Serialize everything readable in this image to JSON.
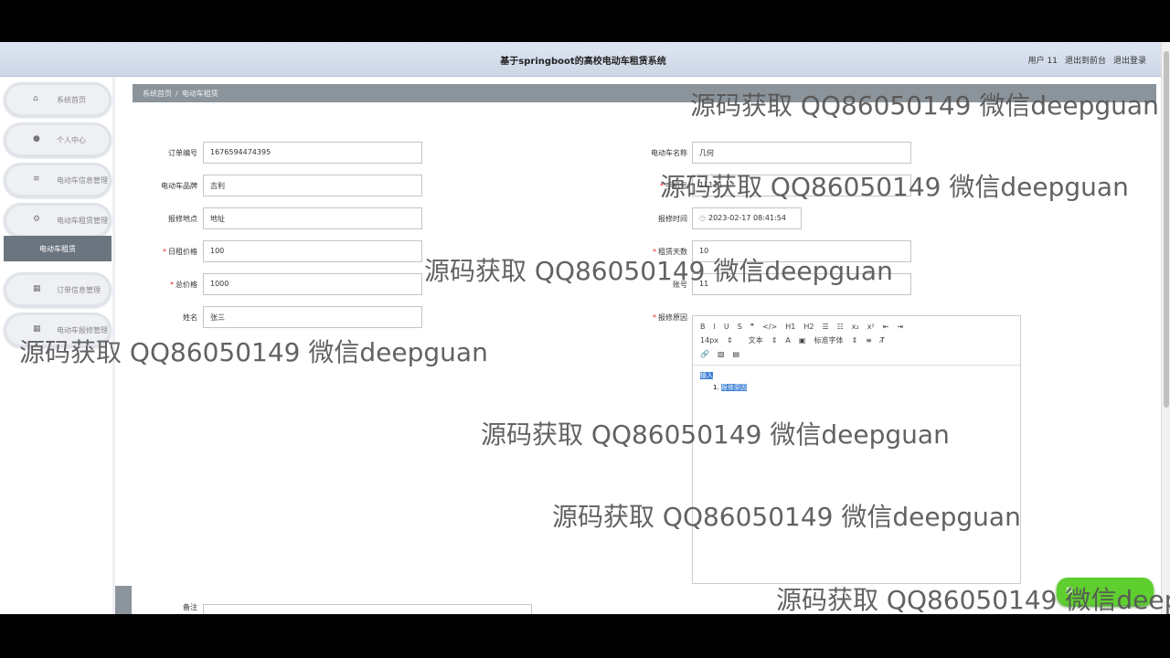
{
  "header": {
    "title": "基于springboot的高校电动车租赁系统",
    "user": "用户 11",
    "to_front": "退出到前台",
    "logout": "退出登录"
  },
  "sidebar": {
    "items": [
      {
        "label": "系统首页",
        "icon": "home-icon"
      },
      {
        "label": "个人中心",
        "icon": "user-icon"
      },
      {
        "label": "电动车信息管理",
        "icon": "list-icon"
      },
      {
        "label": "电动车租赁管理",
        "icon": "bike-icon"
      },
      {
        "label": "订单信息管理",
        "icon": "grid-icon"
      },
      {
        "label": "电动车报修管理",
        "icon": "grid-icon"
      }
    ],
    "active_sub": "电动车租赁"
  },
  "breadcrumb": {
    "home": "系统首页",
    "sep": "/",
    "current": "电动车租赁"
  },
  "form": {
    "order_no": {
      "label": "订单编号",
      "value": "1676594474395"
    },
    "brand": {
      "label": "电动车品牌",
      "value": "吉利"
    },
    "address": {
      "label": "报修地点",
      "value": "地址"
    },
    "daily_price": {
      "label": "日租价格",
      "value": "100"
    },
    "total_price": {
      "label": "总价格",
      "value": "1000"
    },
    "name": {
      "label": "姓名",
      "value": "张三"
    },
    "bike_name": {
      "label": "电动车名称",
      "value": "几何"
    },
    "phone": {
      "label": "手机号",
      "value": "11111"
    },
    "repair_time": {
      "label": "报修时间",
      "value": "2023-02-17 08:41:54"
    },
    "days": {
      "label": "租赁天数",
      "value": "10"
    },
    "account": {
      "label": "账号",
      "value": "11"
    },
    "reason": {
      "label": "报修原因"
    },
    "remark": {
      "label": "备注"
    }
  },
  "editor": {
    "toolbar1": [
      "B",
      "I",
      "U",
      "S",
      "❞",
      "</>",
      "H1",
      "H2",
      "☰",
      "☷",
      "x₂",
      "x²",
      "⇤",
      "⇥"
    ],
    "font_size": "14px",
    "text_style": "文本",
    "font_family": "标准字体",
    "content_line1": "输入",
    "content_line2": "报修原因"
  },
  "watermark_text": "源码获取 QQ86050149 微信deepguan",
  "submit_hint": "提"
}
